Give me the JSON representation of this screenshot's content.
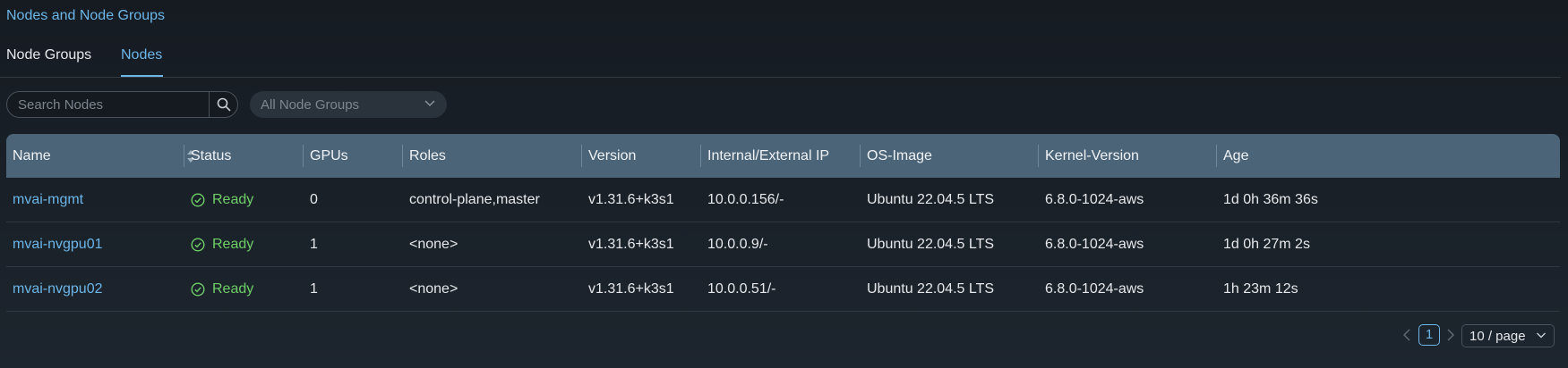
{
  "page": {
    "title": "Nodes and Node Groups"
  },
  "tabs": [
    {
      "label": "Node Groups",
      "active": false
    },
    {
      "label": "Nodes",
      "active": true
    }
  ],
  "search": {
    "placeholder": "Search Nodes",
    "value": ""
  },
  "filter": {
    "selected": "All Node Groups"
  },
  "table": {
    "headers": [
      "Name",
      "Status",
      "GPUs",
      "Roles",
      "Version",
      "Internal/External IP",
      "OS-Image",
      "Kernel-Version",
      "Age"
    ],
    "rows": [
      {
        "name": "mvai-mgmt",
        "status": "Ready",
        "gpus": "0",
        "roles": "control-plane,master",
        "version": "v1.31.6+k3s1",
        "ip": "10.0.0.156/-",
        "os": "Ubuntu 22.04.5 LTS",
        "kernel": "6.8.0-1024-aws",
        "age": "1d 0h 36m 36s"
      },
      {
        "name": "mvai-nvgpu01",
        "status": "Ready",
        "gpus": "1",
        "roles": "<none>",
        "version": "v1.31.6+k3s1",
        "ip": "10.0.0.9/-",
        "os": "Ubuntu 22.04.5 LTS",
        "kernel": "6.8.0-1024-aws",
        "age": "1d 0h 27m 2s"
      },
      {
        "name": "mvai-nvgpu02",
        "status": "Ready",
        "gpus": "1",
        "roles": "<none>",
        "version": "v1.31.6+k3s1",
        "ip": "10.0.0.51/-",
        "os": "Ubuntu 22.04.5 LTS",
        "kernel": "6.8.0-1024-aws",
        "age": "1h 23m 12s"
      }
    ]
  },
  "pagination": {
    "current_page": "1",
    "page_size": "10 / page"
  },
  "icons": {
    "search": "search-icon",
    "dropdown": "chevron-down-icon",
    "sort": "sort-icon",
    "status": "check-circle-icon",
    "prev": "chevron-left-icon",
    "next": "chevron-right-icon"
  },
  "colors": {
    "accent": "#6cb6e8",
    "ready": "#6fcf67",
    "header_bg": "#4b6478"
  }
}
